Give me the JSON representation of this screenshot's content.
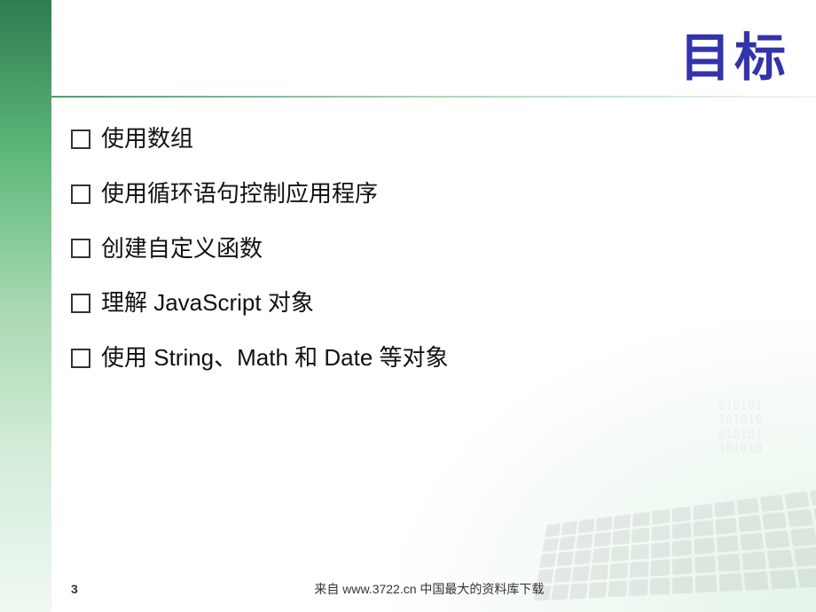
{
  "slide": {
    "title": "目标",
    "bullets": [
      {
        "id": 1,
        "text": "使用数组"
      },
      {
        "id": 2,
        "text": "使用循环语句控制应用程序"
      },
      {
        "id": 3,
        "text": "创建自定义函数"
      },
      {
        "id": 4,
        "text": "理解 JavaScript 对象"
      },
      {
        "id": 5,
        "text": "使用 String、Math 和 Date 等对象"
      }
    ],
    "footer": {
      "page_number": "3",
      "footer_text": "来自 www.3722.cn 中国最大的资料库下载"
    }
  },
  "colors": {
    "title_color": "#3333aa",
    "left_bar_top": "#2e7d4f",
    "left_bar_bottom": "#a8d8b0",
    "text_color": "#111111"
  }
}
